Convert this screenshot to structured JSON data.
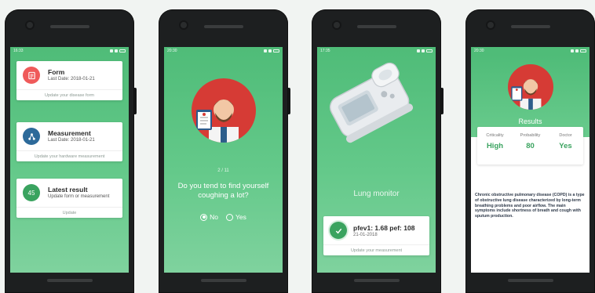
{
  "colors": {
    "accent_green": "#4fbc78",
    "doctor_red": "#d63b35",
    "card_icon_red": "#ef5a5a",
    "card_icon_blue": "#2d6a9a",
    "result_green": "#3aa35f"
  },
  "screen1": {
    "time": "16:33",
    "form": {
      "icon": "form-icon",
      "title": "Form",
      "sub": "Last Date: 2018-01-21",
      "link": "Update your disease form"
    },
    "measurement": {
      "icon": "share-network-icon",
      "title": "Measurement",
      "sub": "Last Date: 2018-01-21",
      "link": "Update your hardware measurement"
    },
    "latest": {
      "badge": "45",
      "title": "Latest result",
      "sub": "Update form or measurement",
      "link": "Update"
    }
  },
  "screen2": {
    "time": "20:30",
    "counter": "2 / 11",
    "question": "Do you tend to find yourself coughing a lot?",
    "options": [
      {
        "label": "No",
        "selected": true
      },
      {
        "label": "Yes",
        "selected": false
      }
    ]
  },
  "screen3": {
    "time": "17:35",
    "title": "Lung monitor",
    "reading": "pfev1: 1.68 pef: 108",
    "date": "21-01-2018",
    "link": "Update your measurement"
  },
  "screen4": {
    "time": "20:30",
    "title": "Results",
    "columns": [
      {
        "label": "Criticality",
        "value": "High"
      },
      {
        "label": "Probability",
        "value": "80"
      },
      {
        "label": "Doctor",
        "value": "Yes"
      }
    ],
    "description": "Chronic obstructive pulmonary disease (COPD) is a type of obstructive lung disease characterized by long-term breathing problems and poor airflow. The main symptoms include shortness of breath and cough with sputum production."
  }
}
